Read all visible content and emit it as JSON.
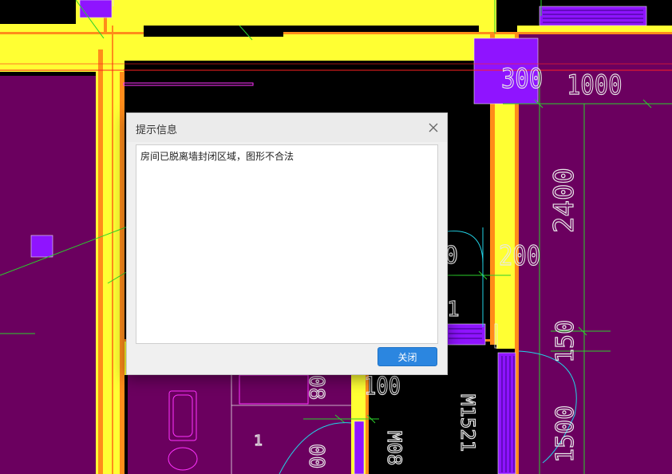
{
  "dialog": {
    "title": "提示信息",
    "message": "房间已脱离墙封闭区域，图形不合法",
    "button_label": "关闭",
    "close_icon": "close-icon"
  },
  "drawing": {
    "dimensions": [
      "300",
      "1000",
      "2400",
      "200",
      "150",
      "1500",
      "100"
    ],
    "door_labels": [
      "M1521",
      "M08"
    ],
    "partial_labels": [
      "0",
      "1",
      "08",
      "1",
      "00"
    ]
  },
  "colors": {
    "room_fill": "#6b005f",
    "wall": "#ffff33",
    "wall_edge": "#ff8c1a",
    "column": "#8f14ff",
    "dim_line": "#2bd12b",
    "axis_line": "#ff2020",
    "door_arc": "#22d3e6",
    "furniture": "#ff33ff",
    "button": "#2b86e0"
  }
}
